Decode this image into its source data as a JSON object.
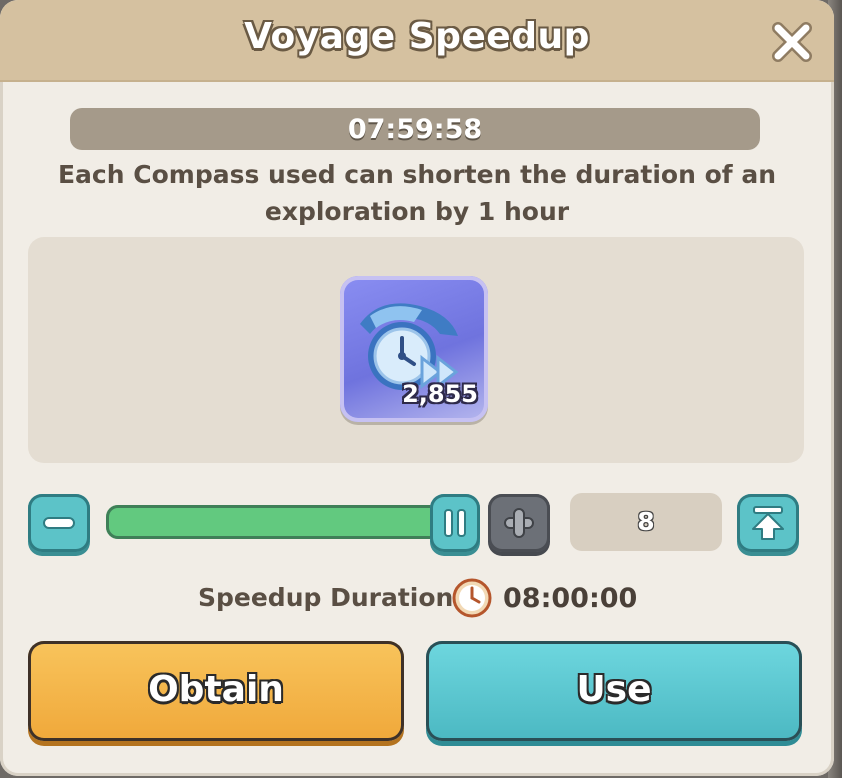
{
  "dialog": {
    "title": "Voyage Speedup",
    "close_icon": "close-x-icon"
  },
  "timer": {
    "remaining": "07:59:58"
  },
  "description": "Each Compass used can shorten the duration of an exploration by 1 hour",
  "item": {
    "icon": "compass-clock-speedup-icon",
    "count": "2,855"
  },
  "quantity": {
    "minus_icon": "minus-icon",
    "plus_icon": "plus-icon",
    "max_icon": "max-arrow-up-icon",
    "handle_icon": "pause-bars-icon",
    "value": "8",
    "slider_fill_fraction": 1.0,
    "accent": "#62c97f"
  },
  "duration": {
    "label": "Speedup Duration:",
    "icon": "clock-icon",
    "value": "08:00:00"
  },
  "buttons": {
    "obtain_label": "Obtain",
    "use_label": "Use",
    "obtain_color": "#f0a83a",
    "use_color": "#4bb8c2"
  }
}
